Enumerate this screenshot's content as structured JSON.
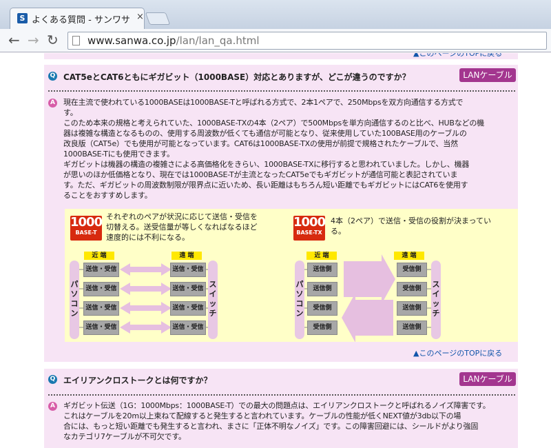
{
  "browser": {
    "tab_title": "よくある質問 - サンワサ",
    "tab_close": "×",
    "favicon": "S",
    "url_host": "www.sanwa.co.jp",
    "url_path": "/lan/lan_qa.html"
  },
  "faq": [
    {
      "q_icon": "Q",
      "a_icon": "A",
      "question": "CAT5eとCAT6ともにギガビット（1000BASE）対応とありますが、どこが違うのですか？",
      "tag": "LANケーブル",
      "answer_lines": [
        "現在主流で使われている1000BASEは1000BASE-Tと呼ばれる方式で、2本1ペアで、250Mbpsを双方向通信する方式で",
        "す。",
        "このため本来の規格と考えられていた、1000BASE-TXの4本（2ペア）で500Mbpsを単方向通信するのと比べ、HUBなどの機",
        "器は複雑な構造となるものの、使用する周波数が低くても通信が可能となり、従来使用していた100BASE用のケーブルの",
        "改良版（CAT5e）でも使用が可能となっています。CAT6は1000BASE-TXの使用が前提で規格されたケーブルで、当然",
        "1000BASE-Tにも使用できます。",
        "ギガビットは機器の構造の複雑さによる高価格化をきらい、1000BASE-TXに移行すると思われていました。しかし、機器",
        "が思いのほか低価格となり、現在では1000BASE-Tが主流となったCAT5eでもギガビットが通信可能と表記されていま",
        "す。ただ、ギガビットの周波数制限が限界点に近いため、長い距離はもちろん短い距離でもギガビットにはCAT6を使用す",
        "ることをおすすめします。"
      ],
      "diagram": {
        "left": {
          "badge_top": "1000",
          "badge_bottom": "BASE-T",
          "text_lines": [
            "それぞれのペアが状況に応じて送信・受信を",
            "切替える。送受信量が等しくなればなるほど",
            "速度的には不利になる。"
          ],
          "near_label": "近 端",
          "far_label": "遠 端",
          "pc_label": "パソコン",
          "switch_label": "スイッチ",
          "near_boxes": [
            "送信・受信",
            "送信・受信",
            "送信・受信",
            "送信・受信"
          ],
          "far_boxes": [
            "送信・受信",
            "送信・受信",
            "送信・受信",
            "送信・受信"
          ]
        },
        "right": {
          "badge_top": "1000",
          "badge_bottom": "BASE-TX",
          "text_lines": [
            "4本（2ペア）で送信・受信の役割が決まってい",
            "る。"
          ],
          "near_label": "近 端",
          "far_label": "遠 端",
          "pc_label": "パソコン",
          "switch_label": "スイッチ",
          "near_boxes": [
            "送信側",
            "送信側",
            "受信側",
            "受信側"
          ],
          "far_boxes": [
            "受信側",
            "受信側",
            "送信側",
            "送信側"
          ]
        }
      },
      "top_link": "▲このページのTOPに戻る"
    },
    {
      "q_icon": "Q",
      "a_icon": "A",
      "question": "エイリアンクロストークとは何ですか？",
      "tag": "LANケーブル",
      "answer_lines": [
        "ギガビット伝送（1G：1000Mbps：1000BASE-T）での最大の問題点は、エイリアンクロストークと呼ばれるノイズ障害です。",
        "これはケーブルを20m以上束ねて配線すると発生すると言われています。ケーブルの性能が低くNEXT値が3db以下の場",
        "合には、もっと短い距離でも発生すると言われ、まさに「正体不明なノイズ」です。この障害回避には、シールドがより強固",
        "なカテゴリ7ケーブルが不可欠です。"
      ]
    }
  ],
  "prev_top_link": "▲このページのTOPに戻る"
}
